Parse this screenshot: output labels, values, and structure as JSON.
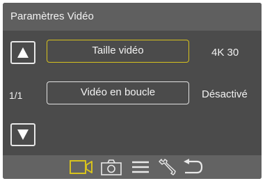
{
  "header": {
    "title": "Paramètres Vidéo"
  },
  "nav": {
    "up_icon": "arrow-up-icon",
    "down_icon": "arrow-down-icon"
  },
  "pagination": {
    "text": "1/1"
  },
  "options": [
    {
      "label": "Taille vidéo",
      "value": "4K 30",
      "selected": true
    },
    {
      "label": "Vidéo en boucle",
      "value": "Désactivé",
      "selected": false
    }
  ],
  "tabs": [
    {
      "icon": "video-camera-icon",
      "active": true
    },
    {
      "icon": "camera-icon",
      "active": false
    },
    {
      "icon": "menu-icon",
      "active": false
    },
    {
      "icon": "wrench-icon",
      "active": false
    },
    {
      "icon": "back-icon",
      "active": false
    }
  ],
  "colors": {
    "background": "#4b4b4b",
    "header": "#5f5f5f",
    "bottom_bar": "#636363",
    "accent": "#d7c21e",
    "text": "#f2f2f2"
  }
}
